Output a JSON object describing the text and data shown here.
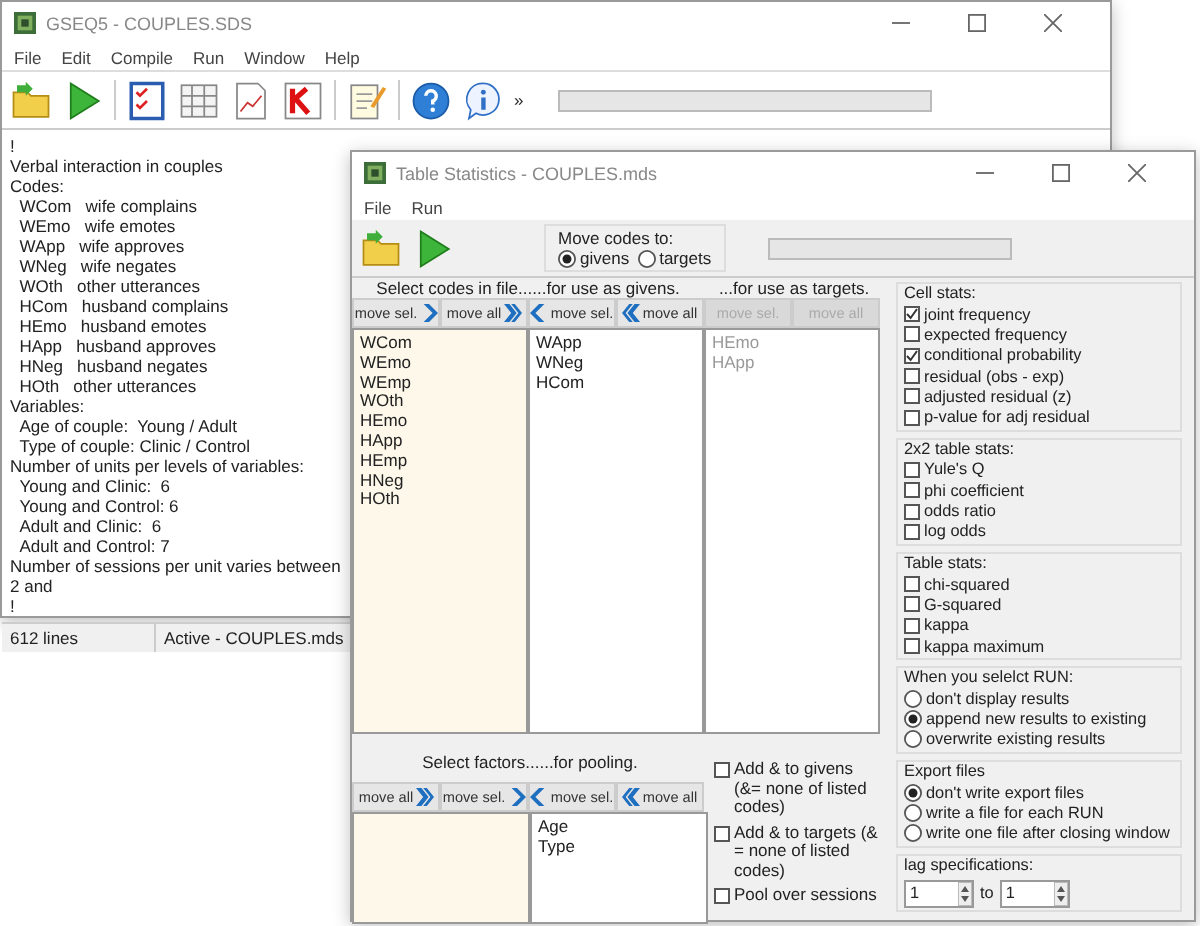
{
  "main_window": {
    "title": "GSEQ5 - COUPLES.SDS",
    "menu": [
      "File",
      "Edit",
      "Compile",
      "Run",
      "Window",
      "Help"
    ],
    "overflow": "»",
    "progress": {
      "level": 0
    },
    "lines": [
      "!",
      "Verbal interaction in couples",
      "Codes:",
      "  WCom   wife complains",
      "  WEmo   wife emotes",
      "  WApp   wife approves",
      "  WNeg   wife negates",
      "  WOth   other utterances",
      "  HCom   husband complains",
      "  HEmo   husband emotes",
      "  HApp   husband approves",
      "  HNeg   husband negates",
      "  HOth   other utterances",
      "Variables:",
      "  Age of couple:  Young / Adult",
      "  Type of couple: Clinic / Control",
      "Number of units per levels of variables:",
      "  Young and Clinic:  6",
      "  Young and Control: 6",
      "  Adult and Clinic:  6",
      "  Adult and Control: 7",
      "Number of sessions per unit varies between 2 and",
      "!"
    ],
    "status_bar": [
      "612 lines",
      "Active - COUPLES.mds"
    ]
  },
  "dialog": {
    "title": "Table Statistics - COUPLES.mds",
    "menu": [
      "File",
      "Run"
    ],
    "progress": {
      "level": 0
    },
    "move_codes_to": {
      "label": "Move codes to:",
      "options": [
        {
          "label": "givens",
          "selected": true
        },
        {
          "label": "targets",
          "selected": false
        }
      ]
    },
    "code_headers": [
      "Select codes in file...",
      "...for use as givens.",
      "...for use as targets."
    ],
    "code_buttons": [
      {
        "label": "move sel.",
        "kind": "right",
        "disabled": false
      },
      {
        "label": "move all",
        "kind": "double-right",
        "disabled": false
      },
      {
        "label": "move sel.",
        "kind": "left",
        "disabled": false
      },
      {
        "label": "move all",
        "kind": "double-left",
        "disabled": false
      },
      {
        "label": "move sel.",
        "kind": "plain",
        "disabled": true
      },
      {
        "label": "move all",
        "kind": "plain",
        "disabled": true
      }
    ],
    "code_lists": [
      {
        "kind": "source",
        "items": [
          "WCom",
          "WEmo",
          "WEmp",
          "WOth",
          "HEmo",
          "HApp",
          "HEmp",
          "HNeg",
          "HOth"
        ]
      },
      {
        "kind": "target",
        "items": [
          "WApp",
          "WNeg",
          "HCom"
        ]
      },
      {
        "kind": "inactive",
        "items": [
          "HEmo",
          "HApp"
        ]
      }
    ],
    "factor_headers": [
      "Select factors...",
      "...for pooling."
    ],
    "factor_buttons": [
      {
        "label": "move all",
        "kind": "double-right",
        "disabled": false
      },
      {
        "label": "move sel.",
        "kind": "right",
        "disabled": false
      },
      {
        "label": "move sel.",
        "kind": "left",
        "disabled": false
      },
      {
        "label": "move all",
        "kind": "double-left",
        "disabled": false
      }
    ],
    "factor_lists": [
      {
        "kind": "source"
      },
      {
        "kind": "target",
        "items": [
          "Age",
          "Type"
        ]
      }
    ],
    "pool_options": [
      {
        "label": "Add & to givens (&= none of listed codes)",
        "checked": false
      },
      {
        "label": "Add & to targets (& = none of listed codes)",
        "checked": false
      },
      {
        "label": "Pool over sessions",
        "checked": false
      }
    ],
    "groups": [
      {
        "title": "Cell stats:",
        "kind": "checkboxes",
        "options": [
          {
            "label": "joint frequency",
            "checked": true
          },
          {
            "label": "expected frequency",
            "checked": false
          },
          {
            "label": "conditional probability",
            "checked": true
          },
          {
            "label": "residual (obs - exp)",
            "checked": false
          },
          {
            "label": "adjusted residual (z)",
            "checked": false
          },
          {
            "label": "p-value for adj residual",
            "checked": false
          }
        ]
      },
      {
        "title": "2x2 table stats:",
        "kind": "checkboxes",
        "options": [
          {
            "label": "Yule's Q",
            "checked": false
          },
          {
            "label": "phi coefficient",
            "checked": false
          },
          {
            "label": "odds ratio",
            "checked": false
          },
          {
            "label": "log odds",
            "checked": false
          }
        ]
      },
      {
        "title": "Table stats:",
        "kind": "checkboxes",
        "options": [
          {
            "label": "chi-squared",
            "checked": false
          },
          {
            "label": "G-squared",
            "checked": false
          },
          {
            "label": "kappa",
            "checked": false
          },
          {
            "label": "kappa maximum",
            "checked": false
          }
        ]
      },
      {
        "title": "When you selelct RUN:",
        "kind": "radios",
        "options": [
          {
            "label": "don't display results",
            "selected": false
          },
          {
            "label": "append new results to existing",
            "selected": true
          },
          {
            "label": "overwrite existing results",
            "selected": false
          }
        ]
      },
      {
        "title": "Export files",
        "kind": "radios",
        "options": [
          {
            "label": "don't write export files",
            "selected": true
          },
          {
            "label": "write a file for each RUN",
            "selected": false
          },
          {
            "label": "write one file after closing window",
            "selected": false
          }
        ]
      },
      {
        "title": "lag specifications:",
        "kind": "lag",
        "from": "1",
        "to_label": "to",
        "to": "1"
      }
    ]
  }
}
